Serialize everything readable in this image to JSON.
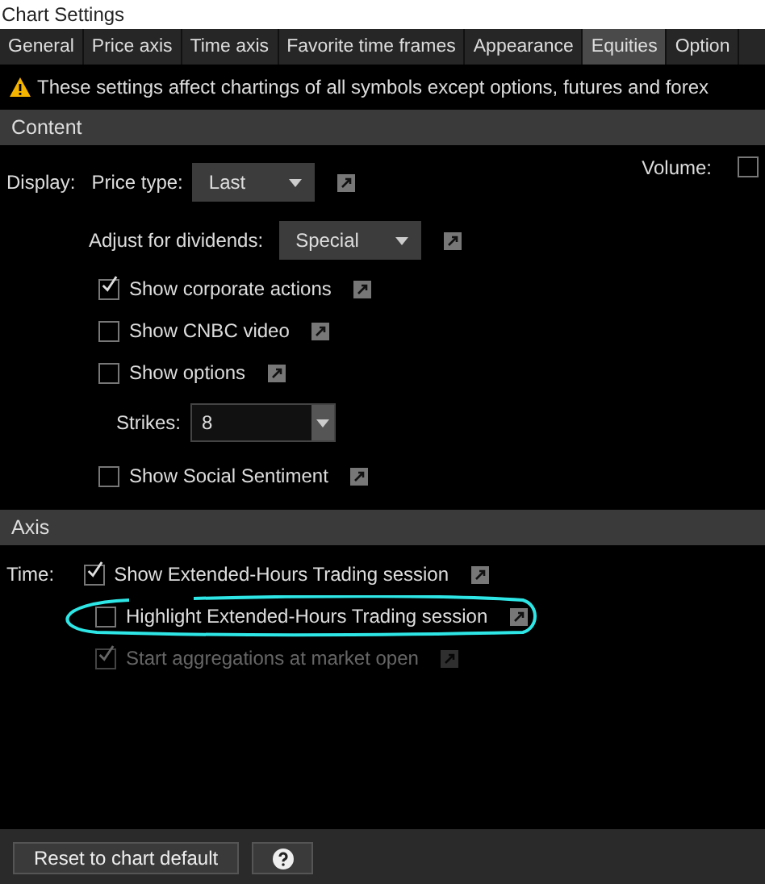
{
  "window": {
    "title": "Chart Settings"
  },
  "tabs": [
    {
      "label": "General",
      "selected": false
    },
    {
      "label": "Price axis",
      "selected": false
    },
    {
      "label": "Time axis",
      "selected": false
    },
    {
      "label": "Favorite time frames",
      "selected": false
    },
    {
      "label": "Appearance",
      "selected": false
    },
    {
      "label": "Equities",
      "selected": true
    },
    {
      "label": "Option",
      "selected": false
    }
  ],
  "warning": "These settings affect chartings of all symbols except options, futures and forex",
  "content": {
    "header": "Content",
    "display_label": "Display:",
    "price_type": {
      "label": "Price type:",
      "value": "Last"
    },
    "volume": {
      "label": "Volume:",
      "checked": false
    },
    "dividends": {
      "label": "Adjust for dividends:",
      "value": "Special"
    },
    "options": [
      {
        "kind": "checkbox",
        "label": "Show corporate actions",
        "checked": true,
        "disabled": false
      },
      {
        "kind": "checkbox",
        "label": "Show CNBC video",
        "checked": false,
        "disabled": false
      },
      {
        "kind": "checkbox",
        "label": "Show options",
        "checked": false,
        "disabled": false
      },
      {
        "kind": "spinner",
        "label": "Strikes:",
        "value": "8"
      },
      {
        "kind": "checkbox",
        "label": "Show Social Sentiment",
        "checked": false,
        "disabled": false
      }
    ]
  },
  "axis": {
    "header": "Axis",
    "time_label": "Time:",
    "options": [
      {
        "label": "Show Extended-Hours Trading session",
        "checked": true,
        "disabled": false
      },
      {
        "label": "Highlight Extended-Hours Trading session",
        "checked": false,
        "disabled": false
      },
      {
        "label": "Start aggregations at market open",
        "checked": true,
        "disabled": true
      }
    ]
  },
  "footer": {
    "buttons": [
      {
        "kind": "text",
        "label": "Reset to chart default"
      },
      {
        "kind": "help"
      }
    ]
  }
}
